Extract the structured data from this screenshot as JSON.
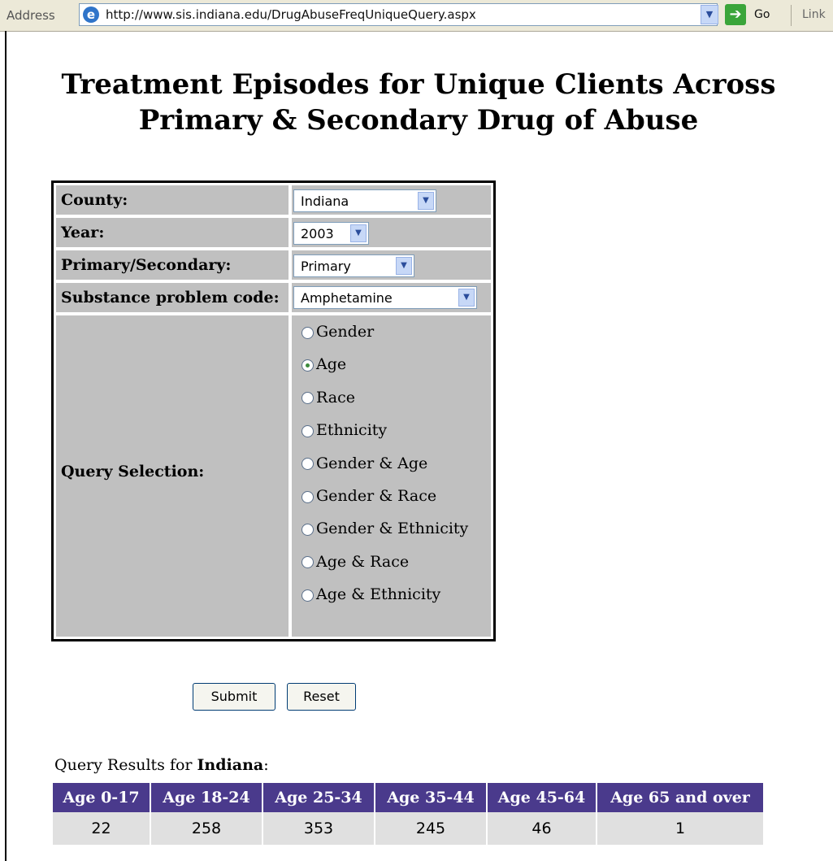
{
  "addressbar": {
    "label": "Address",
    "url": "http://www.sis.indiana.edu/DrugAbuseFreqUniqueQuery.aspx",
    "go_label": "Go",
    "links_label": "Link"
  },
  "page": {
    "title": "Treatment Episodes for Unique Clients Across Primary & Secondary Drug of Abuse"
  },
  "form": {
    "county_label": "County:",
    "county_value": "Indiana",
    "year_label": "Year:",
    "year_value": "2003",
    "primsec_label": "Primary/Secondary:",
    "primsec_value": "Primary",
    "substance_label": "Substance problem code:",
    "substance_value": "Amphetamine",
    "query_label": "Query Selection:",
    "query_options": [
      {
        "label": "Gender",
        "selected": false
      },
      {
        "label": "Age",
        "selected": true
      },
      {
        "label": "Race",
        "selected": false
      },
      {
        "label": "Ethnicity",
        "selected": false
      },
      {
        "label": "Gender & Age",
        "selected": false
      },
      {
        "label": "Gender & Race",
        "selected": false
      },
      {
        "label": "Gender & Ethnicity",
        "selected": false
      },
      {
        "label": "Age & Race",
        "selected": false
      },
      {
        "label": "Age & Ethnicity",
        "selected": false
      }
    ],
    "submit_label": "Submit",
    "reset_label": "Reset"
  },
  "results": {
    "caption_prefix": "Query Results for ",
    "caption_county": "Indiana",
    "caption_suffix": ":",
    "headers": [
      "Age 0-17",
      "Age 18-24",
      "Age 25-34",
      "Age 35-44",
      "Age 45-64",
      "Age 65 and over"
    ],
    "values": [
      "22",
      "258",
      "353",
      "245",
      "46",
      "1"
    ]
  },
  "colors": {
    "results_header_bg": "#4a3a8c",
    "form_cell_bg": "#c0c0c0"
  }
}
